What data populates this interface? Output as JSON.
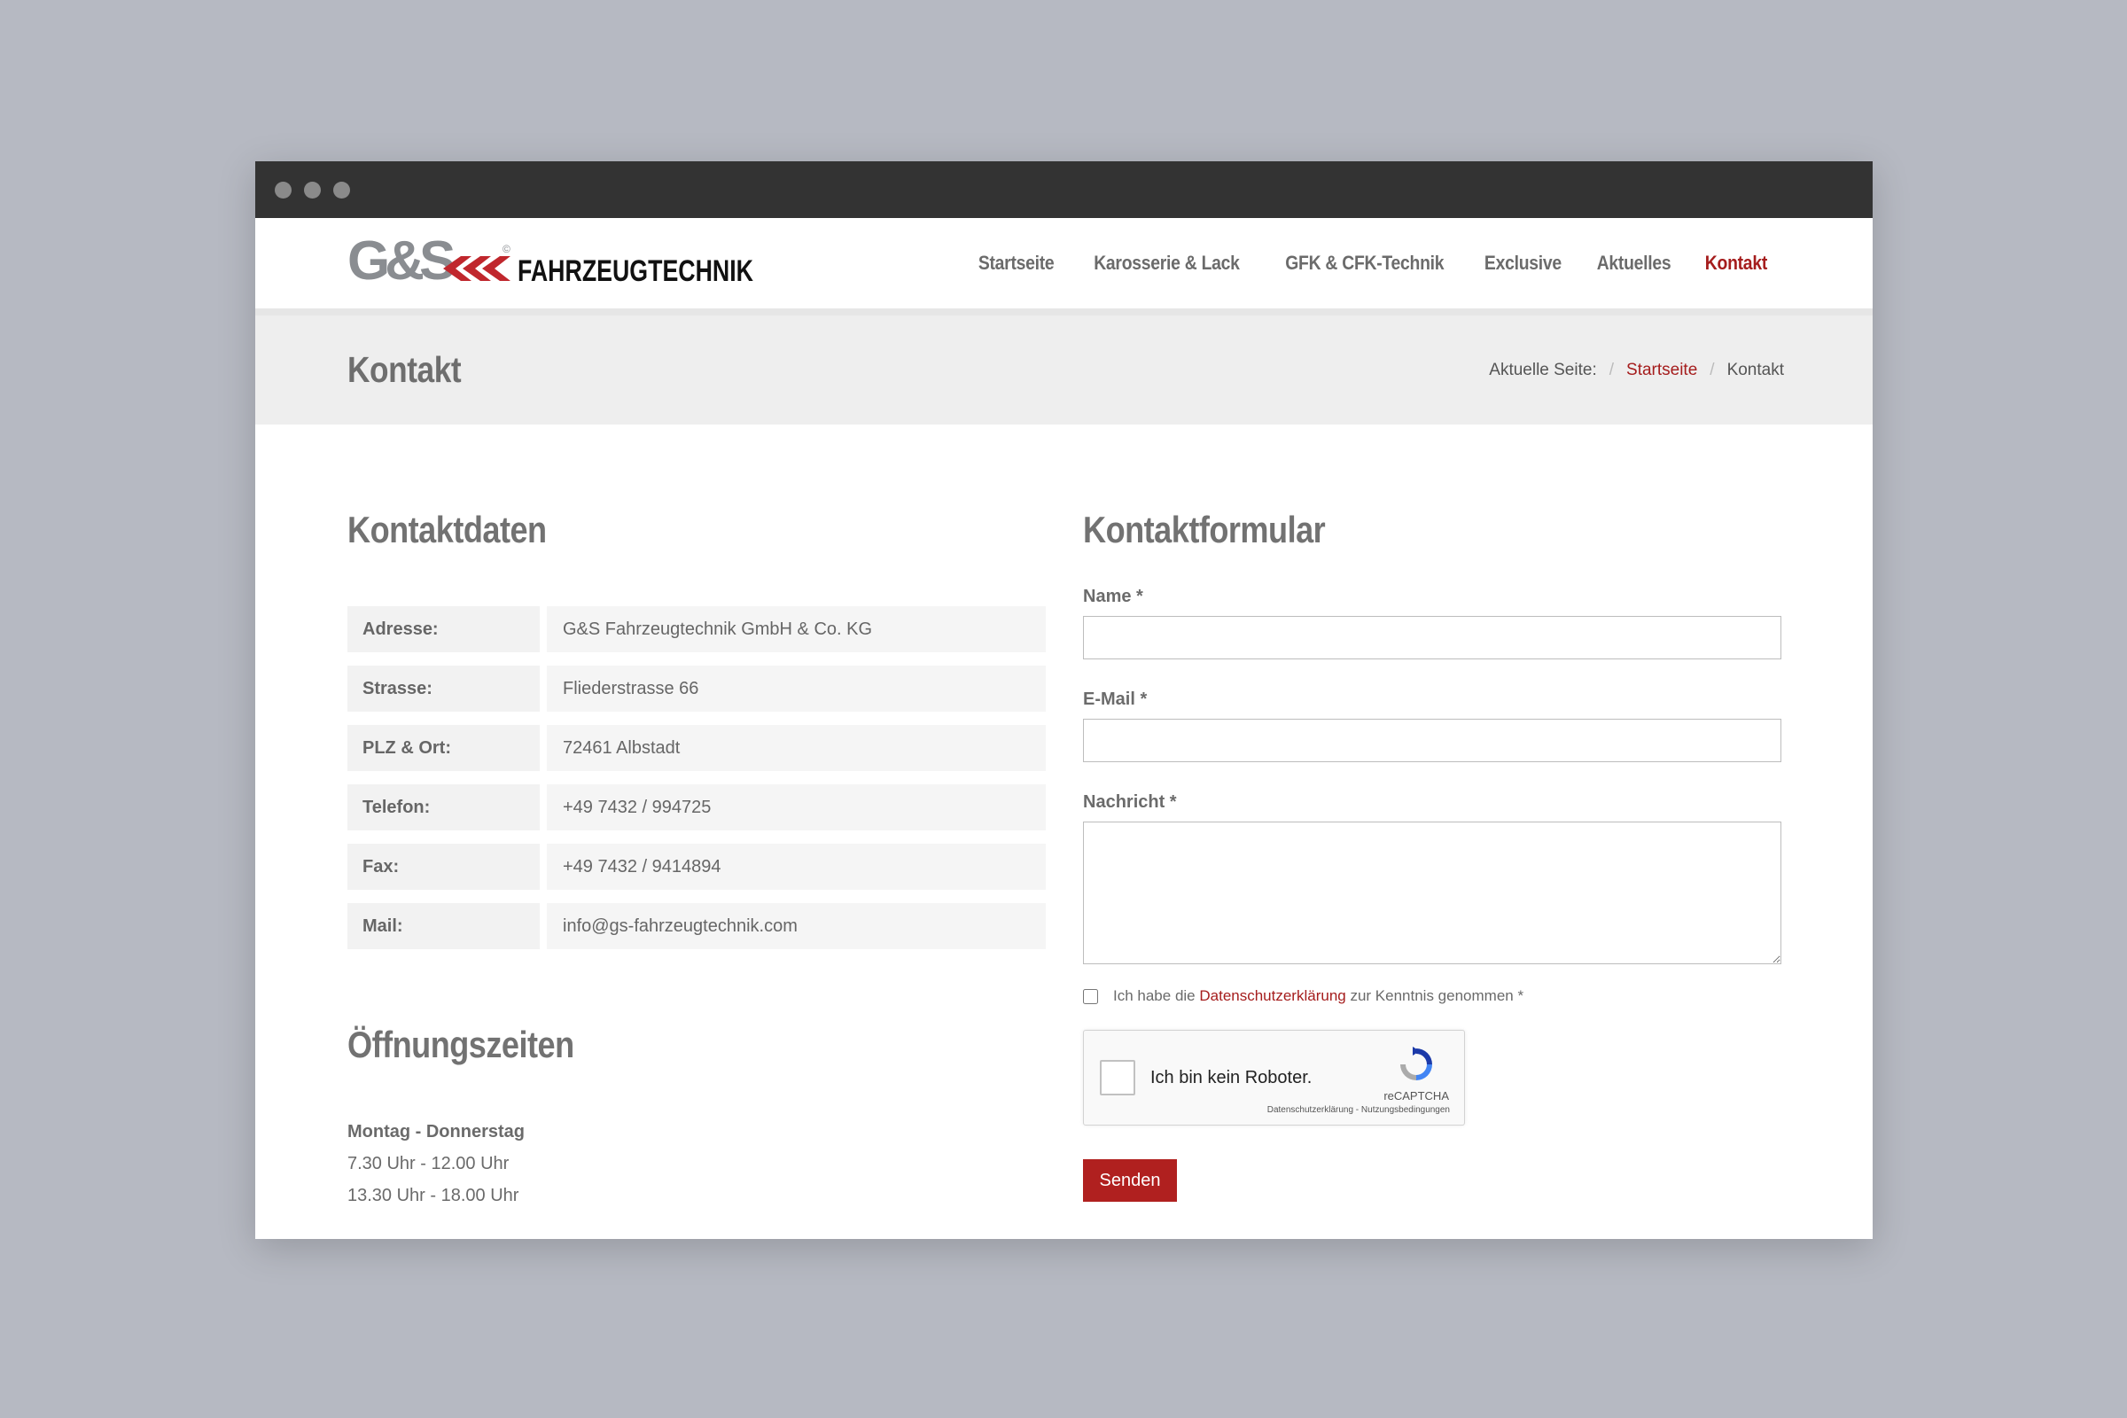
{
  "brand": {
    "logo_mark": "G&S",
    "logo_text": "FAHRZEUGTECHNIK",
    "logo_symbol": "©",
    "accent_color": "#a51d1d"
  },
  "nav": {
    "items": [
      {
        "label": "Startseite"
      },
      {
        "label": "Karosserie & Lack"
      },
      {
        "label": "GFK & CFK-Technik"
      },
      {
        "label": "Exclusive"
      },
      {
        "label": "Aktuelles"
      },
      {
        "label": "Kontakt",
        "active": true
      }
    ]
  },
  "page": {
    "title": "Kontakt",
    "breadcrumb": {
      "prefix": "Aktuelle Seite:",
      "home": "Startseite",
      "current": "Kontakt",
      "separator": "/"
    }
  },
  "contact": {
    "title": "Kontaktdaten",
    "rows": [
      {
        "label": "Adresse:",
        "value": "G&S Fahrzeugtechnik GmbH & Co. KG"
      },
      {
        "label": "Strasse:",
        "value": "Fliederstrasse 66"
      },
      {
        "label": "PLZ & Ort:",
        "value": "72461 Albstadt"
      },
      {
        "label": "Telefon:",
        "value": "+49 7432 / 994725"
      },
      {
        "label": "Fax:",
        "value": "+49 7432 / 9414894"
      },
      {
        "label": "Mail:",
        "value": "info@gs-fahrzeugtechnik.com"
      }
    ]
  },
  "hours": {
    "title": "Öffnungszeiten",
    "day": "Montag - Donnerstag",
    "slot1": "7.30 Uhr - 12.00 Uhr",
    "slot2": "13.30 Uhr - 18.00 Uhr"
  },
  "form": {
    "title": "Kontaktformular",
    "name_label": "Name *",
    "email_label": "E-Mail *",
    "message_label": "Nachricht *",
    "name_value": "",
    "email_value": "",
    "message_value": "",
    "consent_prefix": "Ich habe die ",
    "consent_link": "Datenschutzerklärung",
    "consent_suffix": " zur Kenntnis genommen *",
    "captcha_text": "Ich bin kein Roboter.",
    "captcha_brand": "reCAPTCHA",
    "captcha_links": "Datenschutzerklärung - Nutzungsbedingungen",
    "submit_label": "Senden"
  }
}
